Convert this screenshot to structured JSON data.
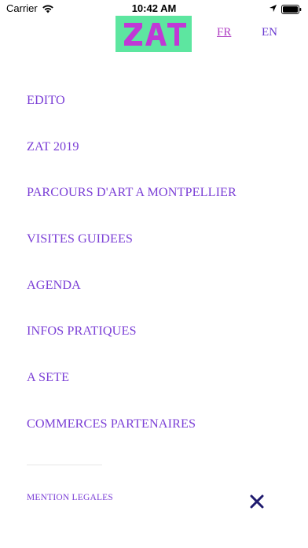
{
  "status_bar": {
    "carrier": "Carrier",
    "time": "10:42 AM"
  },
  "header": {
    "logo_text": "ZAT",
    "lang_fr": "FR",
    "lang_en": "EN"
  },
  "menu": {
    "items": [
      {
        "label": "EDITO"
      },
      {
        "label": "ZAT 2019"
      },
      {
        "label": "PARCOURS D'ART A MONTPELLIER"
      },
      {
        "label": "VISITES GUIDEES"
      },
      {
        "label": "AGENDA"
      },
      {
        "label": "INFOS PRATIQUES"
      },
      {
        "label": "A SETE"
      },
      {
        "label": "COMMERCES PARTENAIRES"
      }
    ]
  },
  "footer": {
    "mentions": "MENTION LEGALES",
    "close_icon": "close-icon"
  },
  "colors": {
    "accent": "#7b3fd6",
    "logo_bg": "#5de6a0",
    "logo_text": "#c038d6",
    "close": "#1f1a6e"
  }
}
